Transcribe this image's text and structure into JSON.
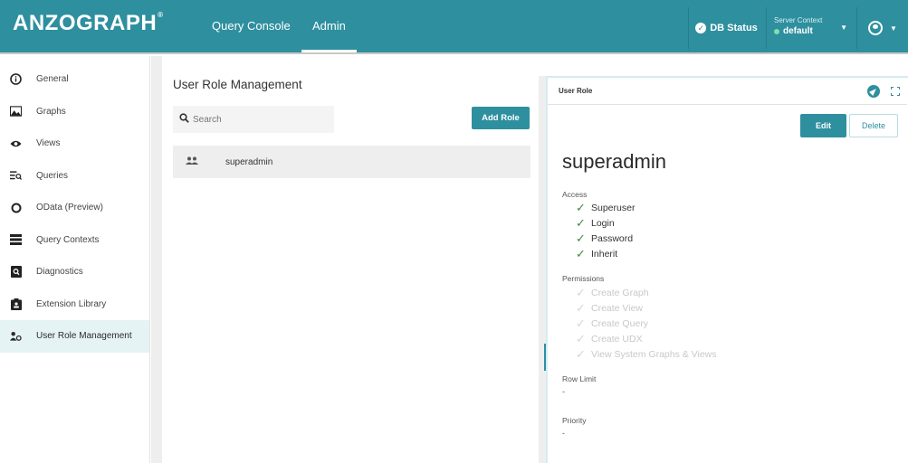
{
  "header": {
    "logo": "ANZOGRAPH",
    "logo_mark": "®",
    "tabs": [
      {
        "label": "Query Console"
      },
      {
        "label": "Admin"
      }
    ],
    "db_status_label": "DB Status",
    "server_context_label": "Server Context",
    "server_context_value": "default"
  },
  "sidebar": {
    "items": [
      {
        "label": "General",
        "icon": "info-icon"
      },
      {
        "label": "Graphs",
        "icon": "image-icon"
      },
      {
        "label": "Views",
        "icon": "eye-icon"
      },
      {
        "label": "Queries",
        "icon": "query-list-icon"
      },
      {
        "label": "OData (Preview)",
        "icon": "odata-icon"
      },
      {
        "label": "Query Contexts",
        "icon": "stack-icon"
      },
      {
        "label": "Diagnostics",
        "icon": "diagnostics-icon"
      },
      {
        "label": "Extension Library",
        "icon": "library-icon"
      },
      {
        "label": "User Role Management",
        "icon": "user-role-icon",
        "active": true
      }
    ]
  },
  "main": {
    "title": "User Role Management",
    "search_placeholder": "Search",
    "add_role_label": "Add Role",
    "roles": [
      {
        "name": "superadmin"
      }
    ]
  },
  "detail": {
    "panel_title": "User Role",
    "edit_label": "Edit",
    "delete_label": "Delete",
    "role_name": "superadmin",
    "access_label": "Access",
    "access": [
      {
        "label": "Superuser",
        "enabled": true
      },
      {
        "label": "Login",
        "enabled": true
      },
      {
        "label": "Password",
        "enabled": true
      },
      {
        "label": "Inherit",
        "enabled": true
      }
    ],
    "permissions_label": "Permissions",
    "permissions": [
      {
        "label": "Create Graph",
        "enabled": false
      },
      {
        "label": "Create View",
        "enabled": false
      },
      {
        "label": "Create Query",
        "enabled": false
      },
      {
        "label": "Create UDX",
        "enabled": false
      },
      {
        "label": "View System Graphs & Views",
        "enabled": false
      }
    ],
    "row_limit_label": "Row Limit",
    "row_limit_value": "-",
    "priority_label": "Priority",
    "priority_value": "-"
  },
  "colors": {
    "accent": "#2e8f9f",
    "check_green": "#3e8a3e"
  }
}
